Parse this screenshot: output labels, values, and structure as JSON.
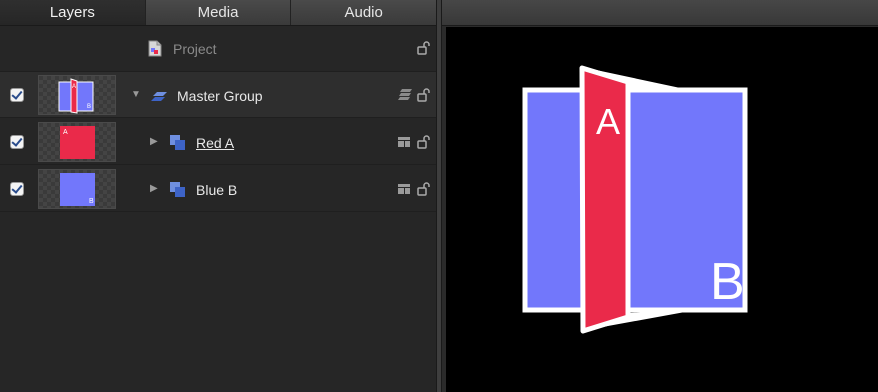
{
  "tabs": [
    {
      "label": "Layers",
      "active": true
    },
    {
      "label": "Media",
      "active": false
    },
    {
      "label": "Audio",
      "active": false
    }
  ],
  "layers": {
    "project": {
      "label": "Project"
    },
    "rows": [
      {
        "label": "Master Group",
        "checked": true,
        "thumb_letter_a": "A",
        "thumb_letter_b": "B"
      },
      {
        "label": "Red A",
        "checked": true,
        "thumb_letter": "A"
      },
      {
        "label": "Blue B",
        "checked": true,
        "thumb_letter": "B"
      }
    ]
  },
  "canvas": {
    "letter_a": "A",
    "letter_b": "B"
  },
  "colors": {
    "red": "#ea2a4a",
    "blue": "#7277fb",
    "background": "#000000",
    "white_border": "#ffffff"
  }
}
